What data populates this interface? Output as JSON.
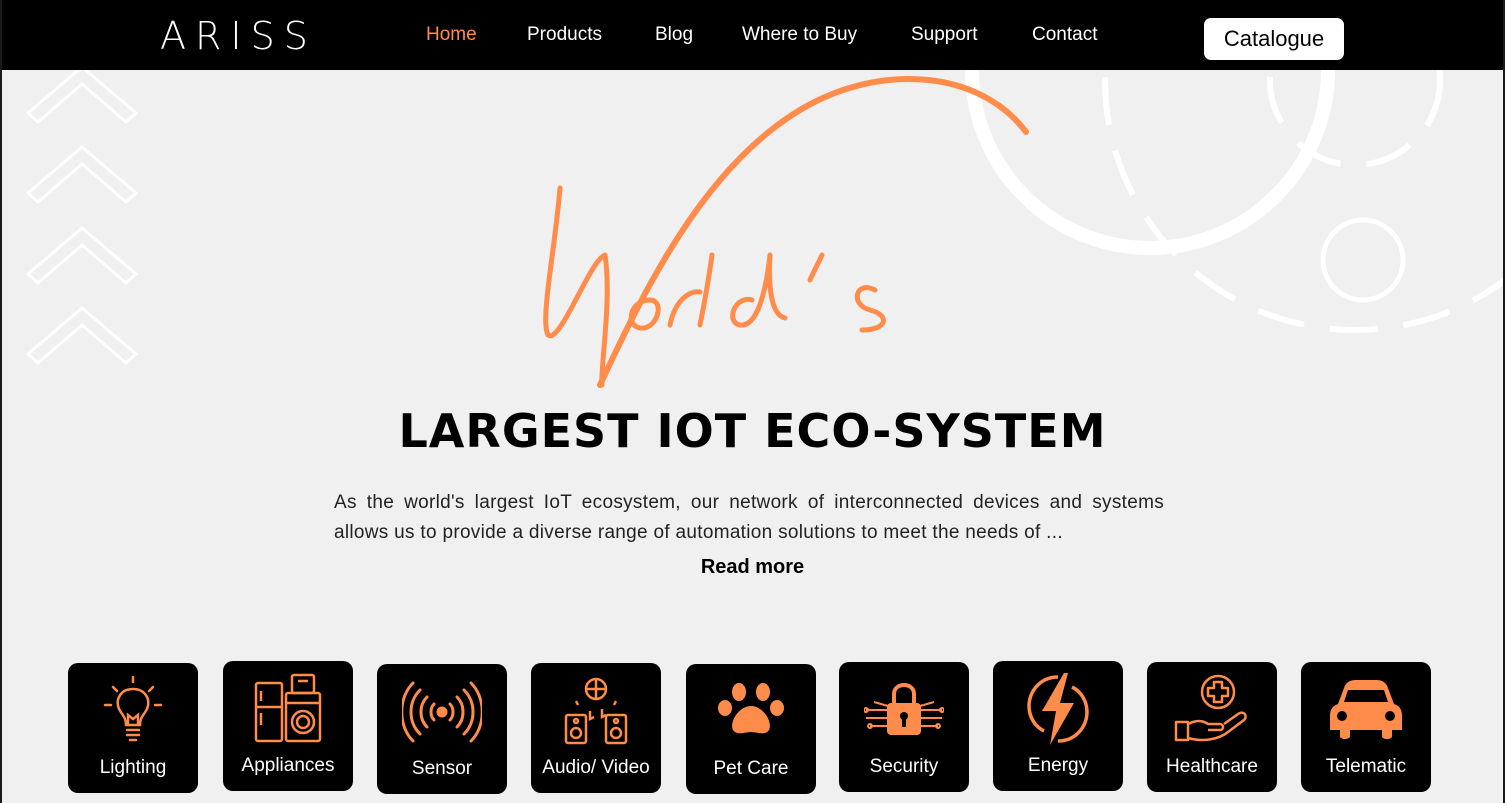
{
  "brand": {
    "logo": "ARISS",
    "accent": "#ff8c4a",
    "header_bg": "#000000",
    "page_bg": "#f0f0f0"
  },
  "nav": {
    "items": [
      {
        "label": "Home",
        "active": true
      },
      {
        "label": "Products",
        "active": false
      },
      {
        "label": "Blog",
        "active": false
      },
      {
        "label": "Where to Buy",
        "active": false
      },
      {
        "label": "Support",
        "active": false
      },
      {
        "label": "Contact",
        "active": false
      }
    ],
    "catalogue_label": "Catalogue"
  },
  "hero": {
    "script_word": "World's",
    "title": "LARGEST IOT ECO-SYSTEM",
    "description": "As the world's largest IoT ecosystem, our network of interconnected devices and systems allows us to provide a diverse range of automation solutions to meet the needs of ...",
    "read_more": "Read more"
  },
  "categories": [
    {
      "label": "Lighting",
      "icon": "lightbulb-icon"
    },
    {
      "label": "Appliances",
      "icon": "appliances-icon"
    },
    {
      "label": "Sensor",
      "icon": "sensor-icon"
    },
    {
      "label": "Audio/ Video",
      "icon": "audio-video-icon"
    },
    {
      "label": "Pet Care",
      "icon": "paw-icon"
    },
    {
      "label": "Security",
      "icon": "padlock-icon"
    },
    {
      "label": "Energy",
      "icon": "lightning-icon"
    },
    {
      "label": "Healthcare",
      "icon": "healthcare-icon"
    },
    {
      "label": "Telematic",
      "icon": "car-icon"
    }
  ]
}
